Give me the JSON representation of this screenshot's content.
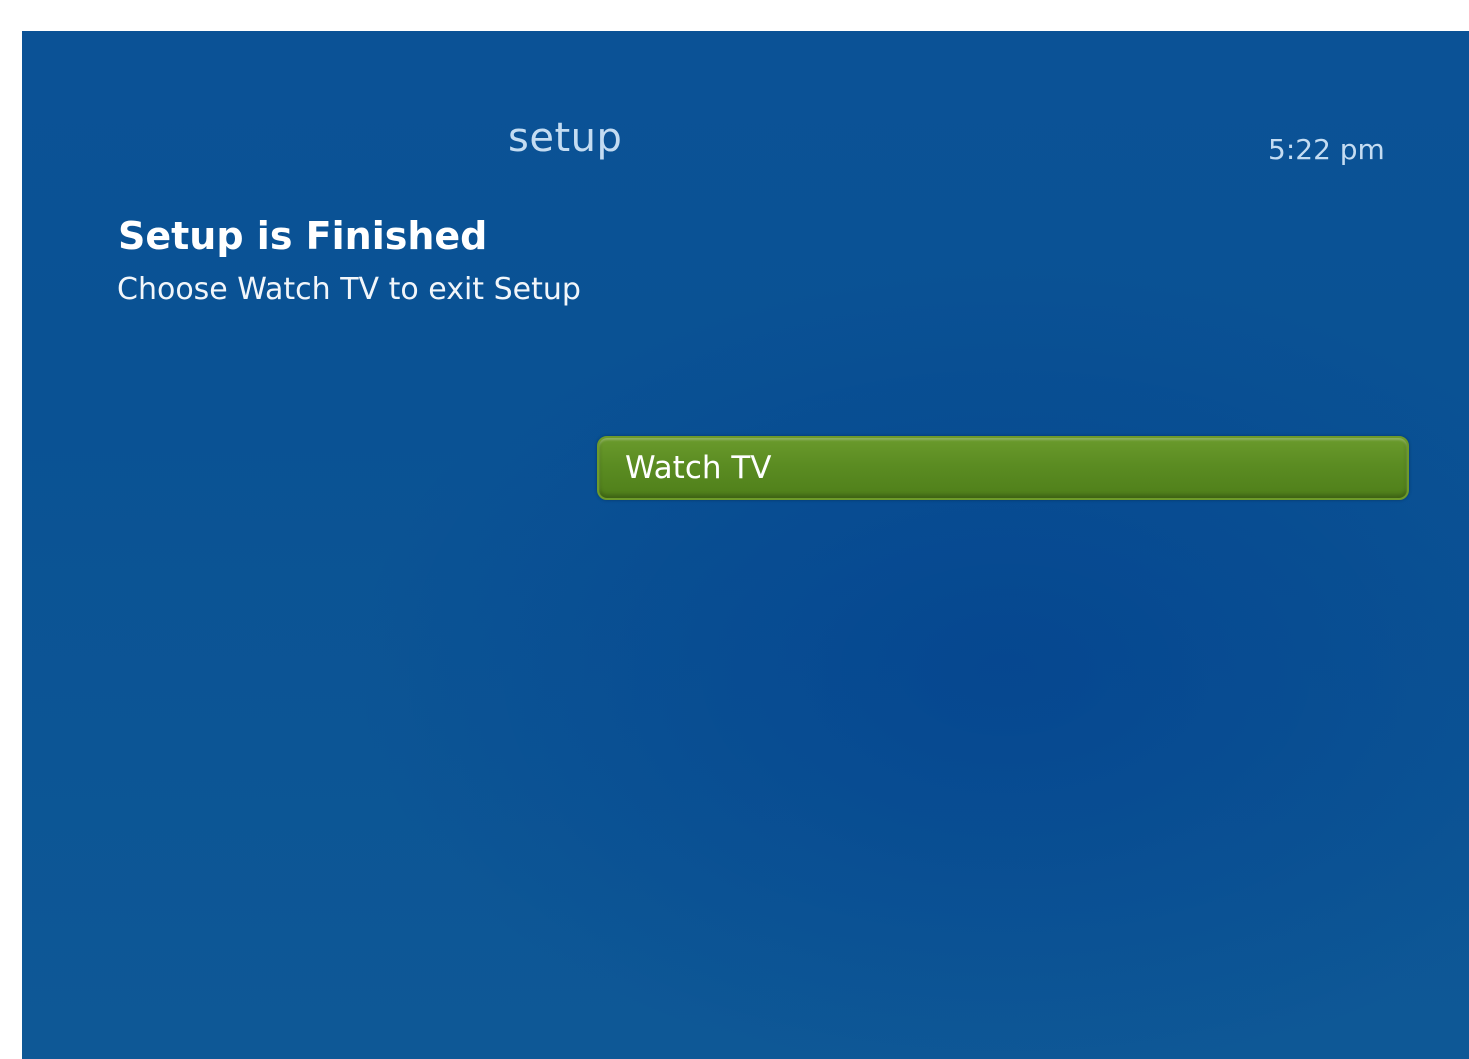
{
  "header": {
    "title": "setup",
    "time": "5:22 pm"
  },
  "main": {
    "heading": "Setup is Finished",
    "subheading": "Choose Watch TV to exit Setup",
    "actions": [
      {
        "label": "Watch TV"
      }
    ]
  },
  "colors": {
    "background": "#0b5296",
    "button": "#5b8c22",
    "title_text": "#c4dcf2"
  }
}
